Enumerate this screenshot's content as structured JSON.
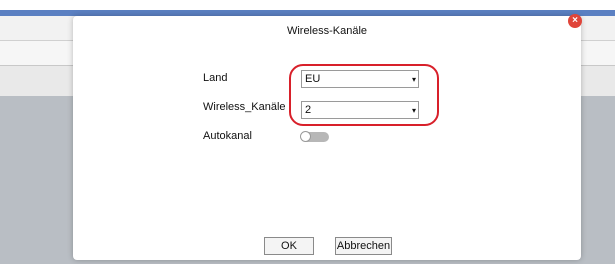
{
  "dialog": {
    "title": "Wireless-Kanäle",
    "close_glyph": "×",
    "fields": {
      "land": {
        "label": "Land",
        "value": "EU"
      },
      "channel": {
        "label": "Wireless_Kanäle",
        "value": "2"
      },
      "autokanal": {
        "label": "Autokanal",
        "enabled": false
      }
    },
    "buttons": {
      "ok": "OK",
      "cancel": "Abbrechen"
    },
    "arrow_glyph": "▾"
  },
  "colors": {
    "highlight": "#d8202a",
    "close": "#e0453a",
    "header_blue": "#5b80c2"
  }
}
